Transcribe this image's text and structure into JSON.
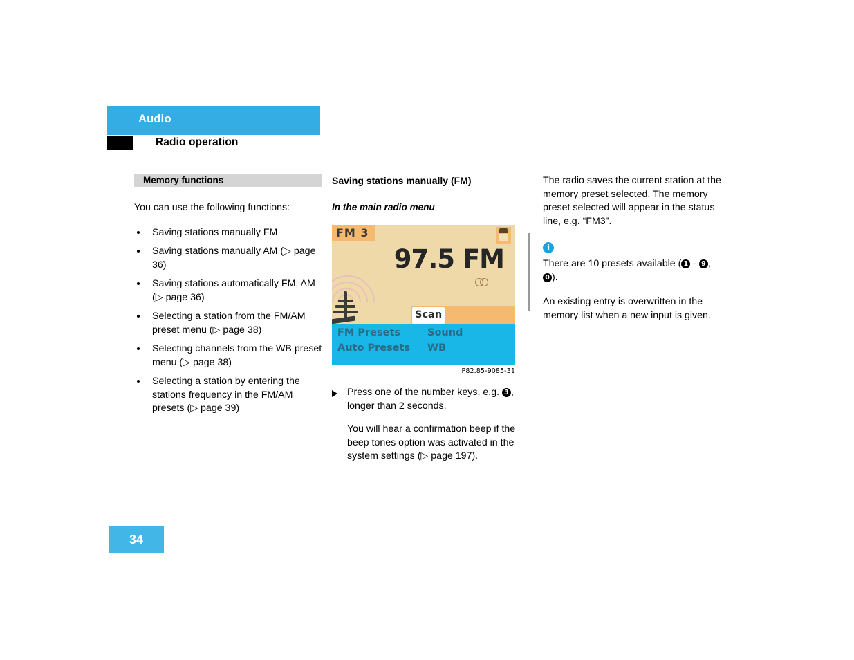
{
  "header": {
    "title": "Audio",
    "subtitle": "Radio operation",
    "band_color": "#33ade4",
    "square_color": "#000000"
  },
  "left_column": {
    "section_bar_label": "Memory functions",
    "intro": "You can use the following functions:",
    "bullets": [
      "Saving stations manually FM",
      "Saving stations manually AM (▷ page 36)",
      "Saving stations automatically FM, AM (▷ page 36)",
      "Selecting a station from the FM/AM preset menu (▷ page 38)",
      "Selecting channels from the WB preset menu (▷ page 38)",
      "Selecting a station by entering the stations frequency in the FM/AM presets (▷ page 39)"
    ]
  },
  "middle_column": {
    "heading": "Saving stations manually (FM)",
    "subheading": "In the main radio menu",
    "figure": {
      "preset_chip": "FM 3",
      "frequency": "97.5 FM",
      "scan_button": "Scan",
      "menu_items": [
        "FM Presets",
        "Auto Presets",
        "Sound",
        "WB"
      ],
      "caption": "P82.85-9085-31",
      "colors": {
        "screen_bg": "#f0d9a8",
        "chip_bg": "#f6b970",
        "menu_bg": "#19b6e8",
        "menu_text": "#2b6a86"
      }
    },
    "step_text_before": "Press one of the number keys, e.g. ",
    "step_key": "3",
    "step_text_after": ", longer than 2 seconds.",
    "step_note": "You will hear a confirmation beep if the beep tones option was activated in the system settings (▷ page 197)."
  },
  "right_column": {
    "intro": "The radio saves the current station at the memory preset selected. The memory preset selected will appear in the status line, e.g. “FM3”.",
    "info_icon_glyph": "i",
    "note_1_before": "There are 10 presets available (",
    "note_1_key_a": "1",
    "note_1_mid": " - ",
    "note_1_key_b": "9",
    "note_1_comma": ", ",
    "note_1_key_c": "0",
    "note_1_after": ").",
    "note_2": "An existing entry is overwritten in the memory list when a new input is given."
  },
  "footer": {
    "page_number": "34",
    "box_color": "#43b6e8"
  }
}
